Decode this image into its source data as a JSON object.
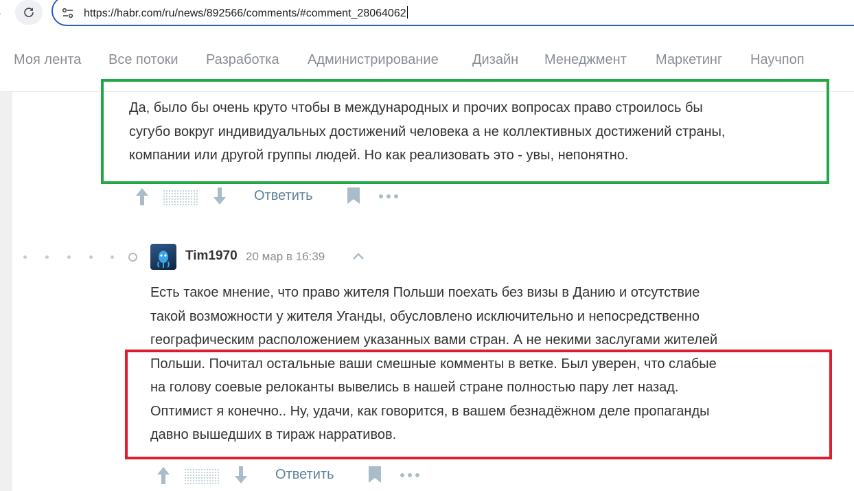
{
  "browser": {
    "url": "https://habr.com/ru/news/892566/comments/#comment_28064062",
    "icons": {
      "reload": "reload-icon",
      "site_info": "tune-icon"
    }
  },
  "nav": {
    "items": [
      "Моя лента",
      "Все потоки",
      "Разработка",
      "Администрирование",
      "Дизайн",
      "Менеджмент",
      "Маркетинг",
      "Научпоп"
    ]
  },
  "comments": [
    {
      "lines": [
        "Да, было бы очень круто чтобы в международных и прочих вопросах право строилось бы",
        "сугубо вокруг индивидуальных достижений человека а не коллективных достижений страны,",
        "компании или другой группы людей. Но как реализовать это - увы, непонятно."
      ],
      "reply_label": "Ответить"
    },
    {
      "author": "Tim1970",
      "timestamp": "20 мар в 16:39",
      "lines": [
        "Есть такое мнение, что право жителя Польши поехать без визы в Данию и отсутствие",
        "такой возможности у жителя Уганды, обусловлено исключительно и непосредственно",
        "географическим расположением указанных вами стран. А не некими заслугами жителей",
        "Польши. Почитал остальные ваши смешные комменты в ветке. Был уверен, что слабые",
        "на голову соевые релоканты вывелись в нашей стране полностью пару лет назад.",
        "Оптимист я конечно.. Ну, удачи, как говорится, в вашем безнадёжном деле пропаганды",
        "давно вышедших в тираж нарративов."
      ],
      "reply_label": "Ответить"
    }
  ],
  "colors": {
    "highlight_green": "#22a745",
    "highlight_red": "#dc1f2e",
    "link": "#5e8399",
    "icon": "#a9bcc7",
    "urlbar_border": "#2a5ccd"
  }
}
